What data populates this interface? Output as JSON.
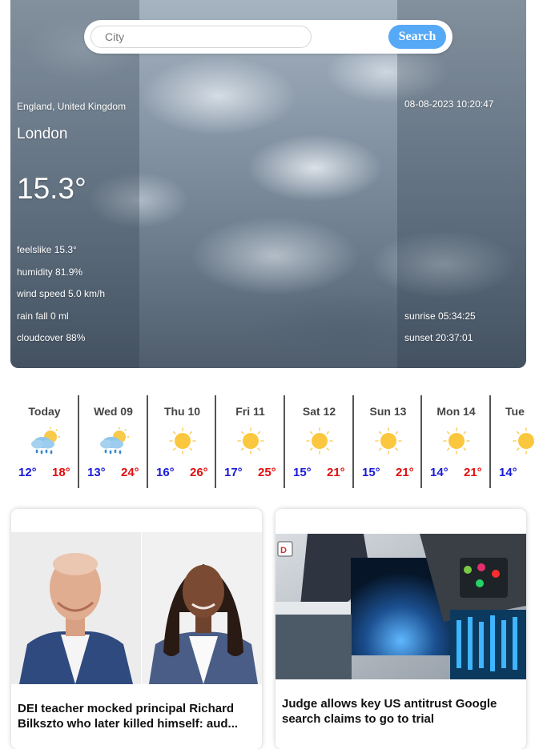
{
  "search": {
    "placeholder": "City",
    "button_label": "Search"
  },
  "current": {
    "location": "England, United Kingdom",
    "city": "London",
    "temperature": "15.3°",
    "datetime": "08-08-2023 10:20:47",
    "stats": {
      "feelslike": "feelslike 15.3°",
      "humidity": "humidity 81.9%",
      "wind": "wind speed 5.0 km/h",
      "rain": "rain fall 0 ml",
      "cloud": "cloudcover 88%"
    },
    "sunrise": "sunrise 05:34:25",
    "sunset": "sunset 20:37:01"
  },
  "forecast": [
    {
      "day": "Today",
      "low": "12°",
      "high": "18°",
      "icon": "rain-sun-icon"
    },
    {
      "day": "Wed 09",
      "low": "13°",
      "high": "24°",
      "icon": "rain-sun-icon"
    },
    {
      "day": "Thu 10",
      "low": "16°",
      "high": "26°",
      "icon": "sun-icon"
    },
    {
      "day": "Fri 11",
      "low": "17°",
      "high": "25°",
      "icon": "sun-icon"
    },
    {
      "day": "Sat 12",
      "low": "15°",
      "high": "21°",
      "icon": "sun-icon"
    },
    {
      "day": "Sun 13",
      "low": "15°",
      "high": "21°",
      "icon": "sun-icon"
    },
    {
      "day": "Mon 14",
      "low": "14°",
      "high": "21°",
      "icon": "sun-icon"
    },
    {
      "day": "Tue",
      "low": "14°",
      "high": "",
      "icon": "sun-icon"
    }
  ],
  "news": [
    {
      "headline": "DEI teacher mocked principal Richard Bilkszto who later killed himself: aud..."
    },
    {
      "headline": "Judge allows key US antitrust Google search claims to go to trial"
    }
  ],
  "colors": {
    "search_button": "#56a9f6",
    "low_temp": "#1a1ad8",
    "high_temp": "#e00d0d"
  }
}
